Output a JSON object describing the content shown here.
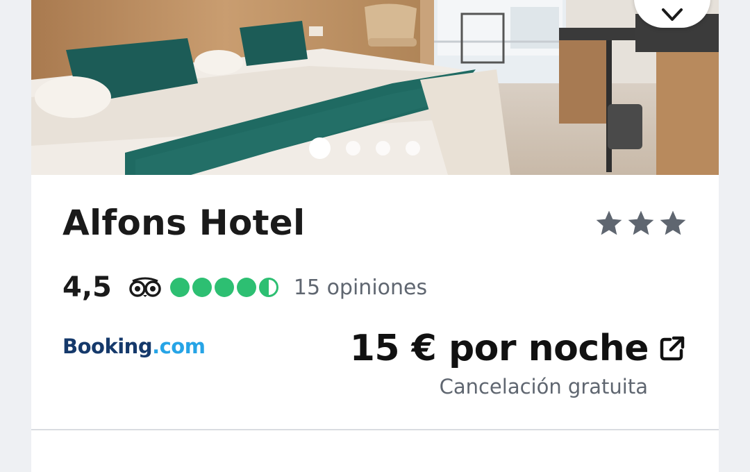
{
  "hotel": {
    "name": "Alfons Hotel",
    "star_count": 3,
    "rating": "4,5",
    "rating_bubbles": 4.5,
    "reviews_label": "15 opiniones"
  },
  "gallery": {
    "image_count": 4,
    "active_index": 0
  },
  "offer": {
    "provider_brand": "Booking",
    "provider_suffix": ".com",
    "price_label": "15 € por noche",
    "cancellation_label": "Cancelación gratuita"
  },
  "icons": {
    "favorite": "heart-icon",
    "external": "external-link-icon",
    "review_logo": "tripadvisor-icon",
    "star": "star-icon"
  },
  "colors": {
    "star": "#5f6670",
    "bubble": "#2dbf72",
    "booking_dark": "#15396b",
    "booking_light": "#26a4e6"
  }
}
